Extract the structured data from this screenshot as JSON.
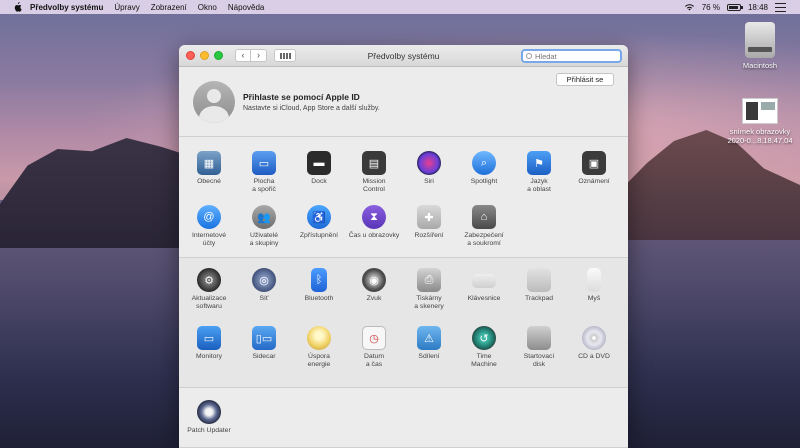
{
  "menubar": {
    "app_name": "Předvolby systému",
    "items": [
      "Úpravy",
      "Zobrazení",
      "Okno",
      "Nápověda"
    ],
    "battery_percent": "76 %",
    "time": "18:48"
  },
  "desktop": {
    "disk_label": "Macintosh",
    "screenshot_label_line1": "snímek obrazovky",
    "screenshot_label_line2": "2020-0...8.18.47.04"
  },
  "window": {
    "title": "Předvolby systému",
    "search_placeholder": "Hledat"
  },
  "apple_id": {
    "title": "Přihlaste se pomocí Apple ID",
    "subtitle": "Nastavte si iCloud, App Store a další služby.",
    "signin_label": "Přihlásit se"
  },
  "prefs": {
    "row1": [
      {
        "l1": "Obecné",
        "l2": "",
        "icon": "general-icon"
      },
      {
        "l1": "Plocha",
        "l2": "a spořič",
        "icon": "desktop-icon"
      },
      {
        "l1": "Dock",
        "l2": "",
        "icon": "dock-icon"
      },
      {
        "l1": "Mission",
        "l2": "Control",
        "icon": "mission-control-icon"
      },
      {
        "l1": "Siri",
        "l2": "",
        "icon": "siri-icon"
      },
      {
        "l1": "Spotlight",
        "l2": "",
        "icon": "spotlight-icon"
      },
      {
        "l1": "Jazyk",
        "l2": "a oblast",
        "icon": "language-icon"
      },
      {
        "l1": "Oznámení",
        "l2": "",
        "icon": "notifications-icon"
      }
    ],
    "row2": [
      {
        "l1": "Internetové",
        "l2": "účty",
        "icon": "internet-accounts-icon"
      },
      {
        "l1": "Uživatelé",
        "l2": "a skupiny",
        "icon": "users-icon"
      },
      {
        "l1": "Zpřístupnění",
        "l2": "",
        "icon": "accessibility-icon"
      },
      {
        "l1": "Čas u obrazovky",
        "l2": "",
        "icon": "screen-time-icon"
      },
      {
        "l1": "Rozšíření",
        "l2": "",
        "icon": "extensions-icon"
      },
      {
        "l1": "Zabezpečení",
        "l2": "a soukromí",
        "icon": "security-icon"
      }
    ],
    "row3": [
      {
        "l1": "Aktualizace",
        "l2": "softwaru",
        "icon": "software-update-icon"
      },
      {
        "l1": "Síť",
        "l2": "",
        "icon": "network-icon"
      },
      {
        "l1": "Bluetooth",
        "l2": "",
        "icon": "bluetooth-icon"
      },
      {
        "l1": "Zvuk",
        "l2": "",
        "icon": "sound-icon"
      },
      {
        "l1": "Tiskárny",
        "l2": "a skenery",
        "icon": "printers-icon"
      },
      {
        "l1": "Klávesnice",
        "l2": "",
        "icon": "keyboard-icon"
      },
      {
        "l1": "Trackpad",
        "l2": "",
        "icon": "trackpad-icon"
      },
      {
        "l1": "Myš",
        "l2": "",
        "icon": "mouse-icon"
      }
    ],
    "row4": [
      {
        "l1": "Monitory",
        "l2": "",
        "icon": "displays-icon"
      },
      {
        "l1": "Sidecar",
        "l2": "",
        "icon": "sidecar-icon"
      },
      {
        "l1": "Úspora",
        "l2": "energie",
        "icon": "energy-saver-icon"
      },
      {
        "l1": "Datum",
        "l2": "a čas",
        "icon": "date-time-icon"
      },
      {
        "l1": "Sdílení",
        "l2": "",
        "icon": "sharing-icon"
      },
      {
        "l1": "Time",
        "l2": "Machine",
        "icon": "time-machine-icon"
      },
      {
        "l1": "Startovací",
        "l2": "disk",
        "icon": "startup-disk-icon"
      },
      {
        "l1": "CD a DVD",
        "l2": "",
        "icon": "cd-dvd-icon"
      }
    ],
    "row5": [
      {
        "l1": "Patch Updater",
        "l2": "",
        "icon": "patch-updater-icon"
      }
    ]
  }
}
